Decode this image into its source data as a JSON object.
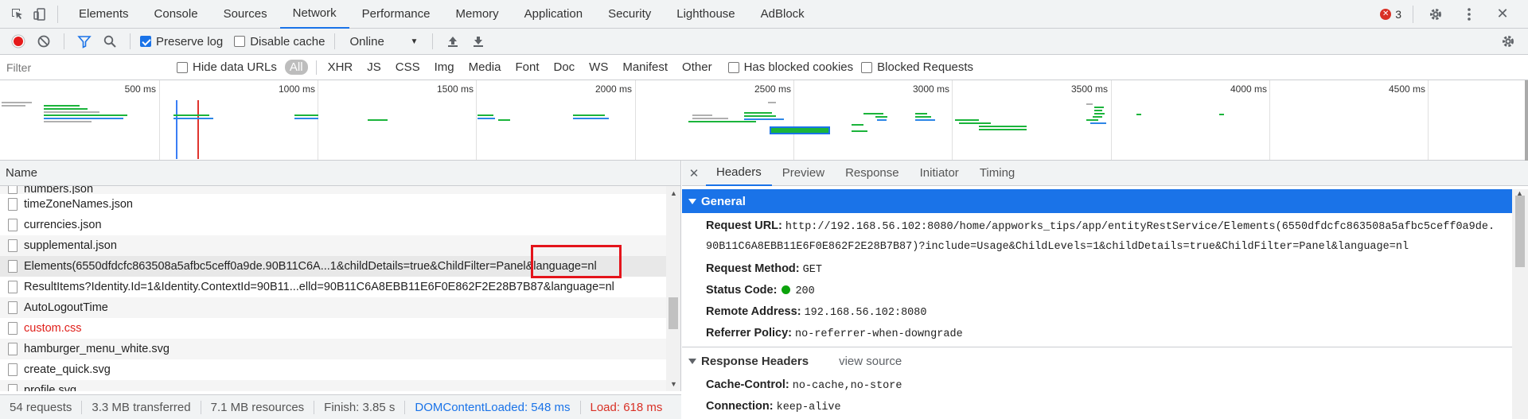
{
  "tabbar": {
    "tabs": [
      "Elements",
      "Console",
      "Sources",
      "Network",
      "Performance",
      "Memory",
      "Application",
      "Security",
      "Lighthouse",
      "AdBlock"
    ],
    "active_tab": "Network",
    "error_count": "3"
  },
  "toolbar": {
    "preserve_log": "Preserve log",
    "disable_cache": "Disable cache",
    "throttle": "Online"
  },
  "filterbar": {
    "placeholder": "Filter",
    "hide_data_urls": "Hide data URLs",
    "types": [
      "All",
      "XHR",
      "JS",
      "CSS",
      "Img",
      "Media",
      "Font",
      "Doc",
      "WS",
      "Manifest",
      "Other"
    ],
    "has_blocked_cookies": "Has blocked cookies",
    "blocked_requests": "Blocked Requests"
  },
  "overview": {
    "ticks": [
      "500 ms",
      "1000 ms",
      "1500 ms",
      "2000 ms",
      "2500 ms",
      "3000 ms",
      "3500 ms",
      "4000 ms",
      "4500 ms"
    ]
  },
  "requests": {
    "column_name": "Name",
    "rows": [
      {
        "name": "numbers.json",
        "error": false
      },
      {
        "name": "timeZoneNames.json",
        "error": false
      },
      {
        "name": "currencies.json",
        "error": false
      },
      {
        "name": "supplemental.json",
        "error": false
      },
      {
        "name": "Elements(6550dfdcfc863508a5afbc5ceff0a9de.90B11C6A...1&childDetails=true&ChildFilter=Panel&language=nl",
        "error": false,
        "selected": true
      },
      {
        "name": "ResultItems?Identity.Id=1&Identity.ContextId=90B11...elld=90B11C6A8EBB11E6F0E862F2E28B7B87&language=nl",
        "error": false
      },
      {
        "name": "AutoLogoutTime",
        "error": false
      },
      {
        "name": "custom.css",
        "error": true
      },
      {
        "name": "hamburger_menu_white.svg",
        "error": false
      },
      {
        "name": "create_quick.svg",
        "error": false
      },
      {
        "name": "profile.svg",
        "error": false
      }
    ]
  },
  "statusbar": {
    "requests": "54 requests",
    "transferred": "3.3 MB transferred",
    "resources": "7.1 MB resources",
    "finish": "Finish: 3.85 s",
    "dcl": "DOMContentLoaded: 548 ms",
    "load": "Load: 618 ms"
  },
  "details": {
    "tabs": [
      "Headers",
      "Preview",
      "Response",
      "Initiator",
      "Timing"
    ],
    "active_tab": "Headers",
    "general_title": "General",
    "request_url_label": "Request URL:",
    "request_url_line1": "http://192.168.56.102:8080/home/appworks_tips/app/entityRestService/Elements(6550dfdcfc863508a5afbc5ceff0a9de.",
    "request_url_line2": "90B11C6A8EBB11E6F0E862F2E28B7B87)?include=Usage&ChildLevels=1&childDetails=true&ChildFilter=Panel&language=nl",
    "request_method_label": "Request Method:",
    "request_method": "GET",
    "status_code_label": "Status Code:",
    "status_code": "200",
    "remote_address_label": "Remote Address:",
    "remote_address": "192.168.56.102:8080",
    "referrer_policy_label": "Referrer Policy:",
    "referrer_policy": "no-referrer-when-downgrade",
    "response_headers_title": "Response Headers",
    "view_source": "view source",
    "cache_control_label": "Cache-Control:",
    "cache_control": "no-cache,no-store",
    "connection_label": "Connection:",
    "connection": "keep-alive"
  },
  "colors": {
    "accent": "#1a73e8",
    "error": "#d93025",
    "highlight_box": "#e4141b"
  }
}
